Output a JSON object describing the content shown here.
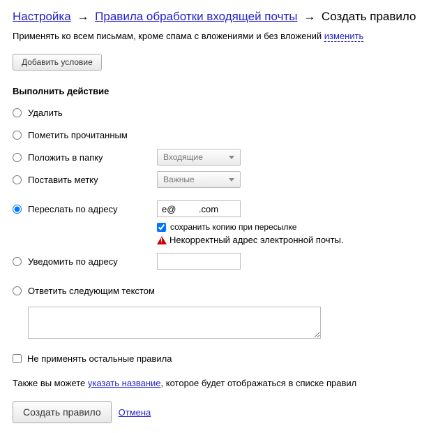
{
  "breadcrumb": {
    "settings": "Настройка",
    "rules": "Правила обработки входящей почты",
    "create": "Создать правило"
  },
  "apply_text": "Применять ко всем письмам, кроме спама с вложениями и без вложений ",
  "apply_change": "изменить",
  "add_condition": "Добавить условие",
  "perform_action": "Выполнить действие",
  "actions": {
    "delete": "Удалить",
    "mark_read": "Пометить прочитанным",
    "move_folder": "Положить в папку",
    "move_folder_sel": "Входящие",
    "set_label": "Поставить метку",
    "set_label_sel": "Важные",
    "forward": "Переслать по адресу",
    "forward_value": "e@         .com",
    "keep_copy": "сохранить копию при пересылке",
    "invalid_email": "Некорректный адрес электронной почты.",
    "notify": "Уведомить по адресу",
    "reply": "Ответить следующим текстом"
  },
  "no_other_rules": "Не применять остальные правила",
  "also_text_pre": "Также вы можете ",
  "also_link": "указать название",
  "also_text_post": ", которое будет отображаться в списке правил",
  "create_rule_btn": "Создать правило",
  "cancel": "Отмена"
}
